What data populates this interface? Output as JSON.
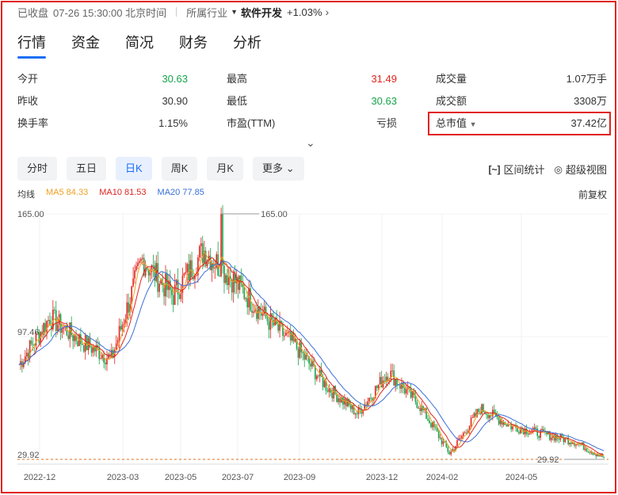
{
  "topbar": {
    "status": "已收盘",
    "datetime": "07-26 15:30:00 北京时间",
    "industry_label": "所属行业",
    "industry_name": "软件开发",
    "industry_change": "+1.03%"
  },
  "tabs": [
    "行情",
    "资金",
    "简况",
    "财务",
    "分析"
  ],
  "metrics": {
    "open_label": "今开",
    "open": "30.63",
    "prev_close_label": "昨收",
    "prev_close": "30.90",
    "turnover_label": "换手率",
    "turnover": "1.15%",
    "high_label": "最高",
    "high": "31.49",
    "low_label": "最低",
    "low": "30.63",
    "pe_label": "市盈(TTM)",
    "pe": "亏损",
    "volume_label": "成交量",
    "volume": "1.07万手",
    "amount_label": "成交额",
    "amount": "3308万",
    "mktcap_label": "总市值",
    "mktcap": "37.42亿"
  },
  "periods": [
    "分时",
    "五日",
    "日K",
    "周K",
    "月K",
    "更多"
  ],
  "tools": {
    "range_stats": "区间统计",
    "super_view": "超级视图"
  },
  "legend": {
    "title": "均线",
    "ma5": "MA5 84.33",
    "ma10": "MA10 81.53",
    "ma20": "MA20 77.85"
  },
  "restore_label": "前复权",
  "colors": {
    "up": "#e0241e",
    "down": "#16a34a",
    "ma5": "#f0a020",
    "ma10": "#e0241e",
    "ma20": "#3b6fd8",
    "accent": "#1a6ff5"
  },
  "chart_data": {
    "type": "line",
    "x": [
      "2022-12",
      "2023-03",
      "2023-05",
      "2023-07",
      "2023-09",
      "2023-12",
      "2024-02",
      "2024-05"
    ],
    "ytick_labels": [
      "165.00",
      "97.46",
      "29.92"
    ],
    "max_label": "165.00",
    "min_label": "29.92",
    "ylim": [
      29.92,
      165.0
    ],
    "series": [
      {
        "name": "close",
        "x": [
          "2022-12",
          "2023-01",
          "2023-02",
          "2023-03",
          "2023-04",
          "2023-05",
          "2023-06",
          "2023-07",
          "2023-08",
          "2023-09",
          "2023-10",
          "2023-11",
          "2023-12",
          "2024-01",
          "2024-02",
          "2024-03",
          "2024-04",
          "2024-05",
          "2024-06",
          "2024-07"
        ],
        "values": [
          82,
          108,
          95,
          85,
          140,
          120,
          145,
          128,
          108,
          92,
          70,
          55,
          78,
          60,
          33,
          58,
          48,
          44,
          40,
          31
        ]
      }
    ]
  }
}
